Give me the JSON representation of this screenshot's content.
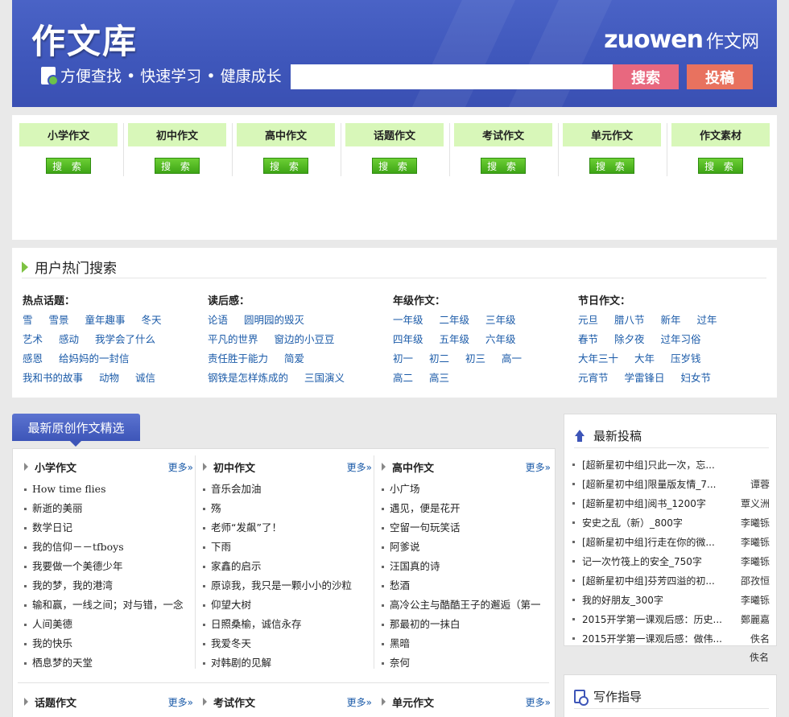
{
  "header": {
    "logo": "作文库",
    "slogan": "方便查找 • 快速学习 • 健康成长",
    "brand_en": "zuowen",
    "brand_cn": "作文网",
    "search_placeholder": "",
    "search_button": "搜索",
    "submit_button": "投稿"
  },
  "categories": [
    {
      "title": "小学作文",
      "button": "搜 索"
    },
    {
      "title": "初中作文",
      "button": "搜 索"
    },
    {
      "title": "高中作文",
      "button": "搜 索"
    },
    {
      "title": "话题作文",
      "button": "搜 索"
    },
    {
      "title": "考试作文",
      "button": "搜 索"
    },
    {
      "title": "单元作文",
      "button": "搜 索"
    },
    {
      "title": "作文素材",
      "button": "搜 索"
    }
  ],
  "hot": {
    "title": "用户热门搜索",
    "groups": [
      {
        "label": "热点话题：",
        "rows": [
          [
            "雪",
            "雪景",
            "童年趣事",
            "冬天"
          ],
          [
            "艺术",
            "感动",
            "我学会了什么"
          ],
          [
            "感恩",
            "给妈妈的一封信"
          ],
          [
            "我和书的故事",
            "动物",
            "诚信"
          ]
        ]
      },
      {
        "label": "读后感：",
        "rows": [
          [
            "论语",
            "圆明园的毁灭"
          ],
          [
            "平凡的世界",
            "窗边的小豆豆"
          ],
          [
            "责任胜于能力",
            "简爱"
          ],
          [
            "钢铁是怎样炼成的",
            "三国演义"
          ]
        ]
      },
      {
        "label": "年级作文：",
        "rows": [
          [
            "一年级",
            "二年级",
            "三年级"
          ],
          [
            "四年级",
            "五年级",
            "六年级"
          ],
          [
            "初一",
            "初二",
            "初三",
            "高一"
          ],
          [
            "高二",
            "高三"
          ]
        ]
      },
      {
        "label": "节日作文：",
        "rows": [
          [
            "元旦",
            "腊八节",
            "新年",
            "过年"
          ],
          [
            "春节",
            "除夕夜",
            "过年习俗"
          ],
          [
            "大年三十",
            "大年",
            "压岁钱"
          ],
          [
            "元宵节",
            "学雷锋日",
            "妇女节"
          ]
        ]
      }
    ]
  },
  "latest": {
    "tab": "最新原创作文精选",
    "more": "更多",
    "columns": [
      {
        "name": "小学作文",
        "items": [
          "How time flies",
          "新逝的美丽",
          "数学日记",
          "我的信仰－－tfboys",
          "我要做一个美德少年",
          "我的梦，我的港湾",
          "输和赢，一线之间；对与错，一念",
          "人间美德",
          "我的快乐",
          "栖息梦的天堂"
        ]
      },
      {
        "name": "初中作文",
        "items": [
          "音乐会加油",
          "殇",
          "老师“发飙”了！",
          "下雨",
          "家鑫的启示",
          "原谅我，我只是一颗小小的沙粒",
          "仰望大树",
          "日照桑榆，诚信永存",
          "我爱冬天",
          "对韩剧的见解"
        ]
      },
      {
        "name": "高中作文",
        "items": [
          "小广场",
          "遇见，便是花开",
          "空留一句玩笑话",
          "阿爹说",
          "汪国真的诗",
          "愁酒",
          "高冷公主与酷酷王子的邂逅（第一",
          "那最初的一抹白",
          "黑暗",
          "奈何"
        ]
      }
    ],
    "columns2": [
      {
        "name": "话题作文"
      },
      {
        "name": "考试作文"
      },
      {
        "name": "单元作文"
      }
    ]
  },
  "submissions": {
    "title": "最新投稿",
    "items": [
      {
        "title": "[超新星初中组]只此一次，忘...",
        "author": ""
      },
      {
        "title": "[超新星初中组]限量版友情_7...",
        "author": "谭蓉"
      },
      {
        "title": "[超新星初中组]阅书_1200字",
        "author": "覃义洲"
      },
      {
        "title": "安史之乱（新）_800字",
        "author": "李曦铄"
      },
      {
        "title": "[超新星初中组]行走在你的微...",
        "author": "李曦铄"
      },
      {
        "title": "记一次竹筏上的安全_750字",
        "author": "李曦铄"
      },
      {
        "title": "[超新星初中组]芬芳四溢的初...",
        "author": "邵孜恒"
      },
      {
        "title": "我的好朋友_300字",
        "author": "李曦铄"
      },
      {
        "title": "2015开学第一课观后感：历史...",
        "author": "鄭麗嘉"
      },
      {
        "title": "2015开学第一课观后感：做伟...",
        "author": "佚名"
      }
    ],
    "extra_author": "佚名"
  },
  "guide": {
    "title": "写作指导"
  }
}
